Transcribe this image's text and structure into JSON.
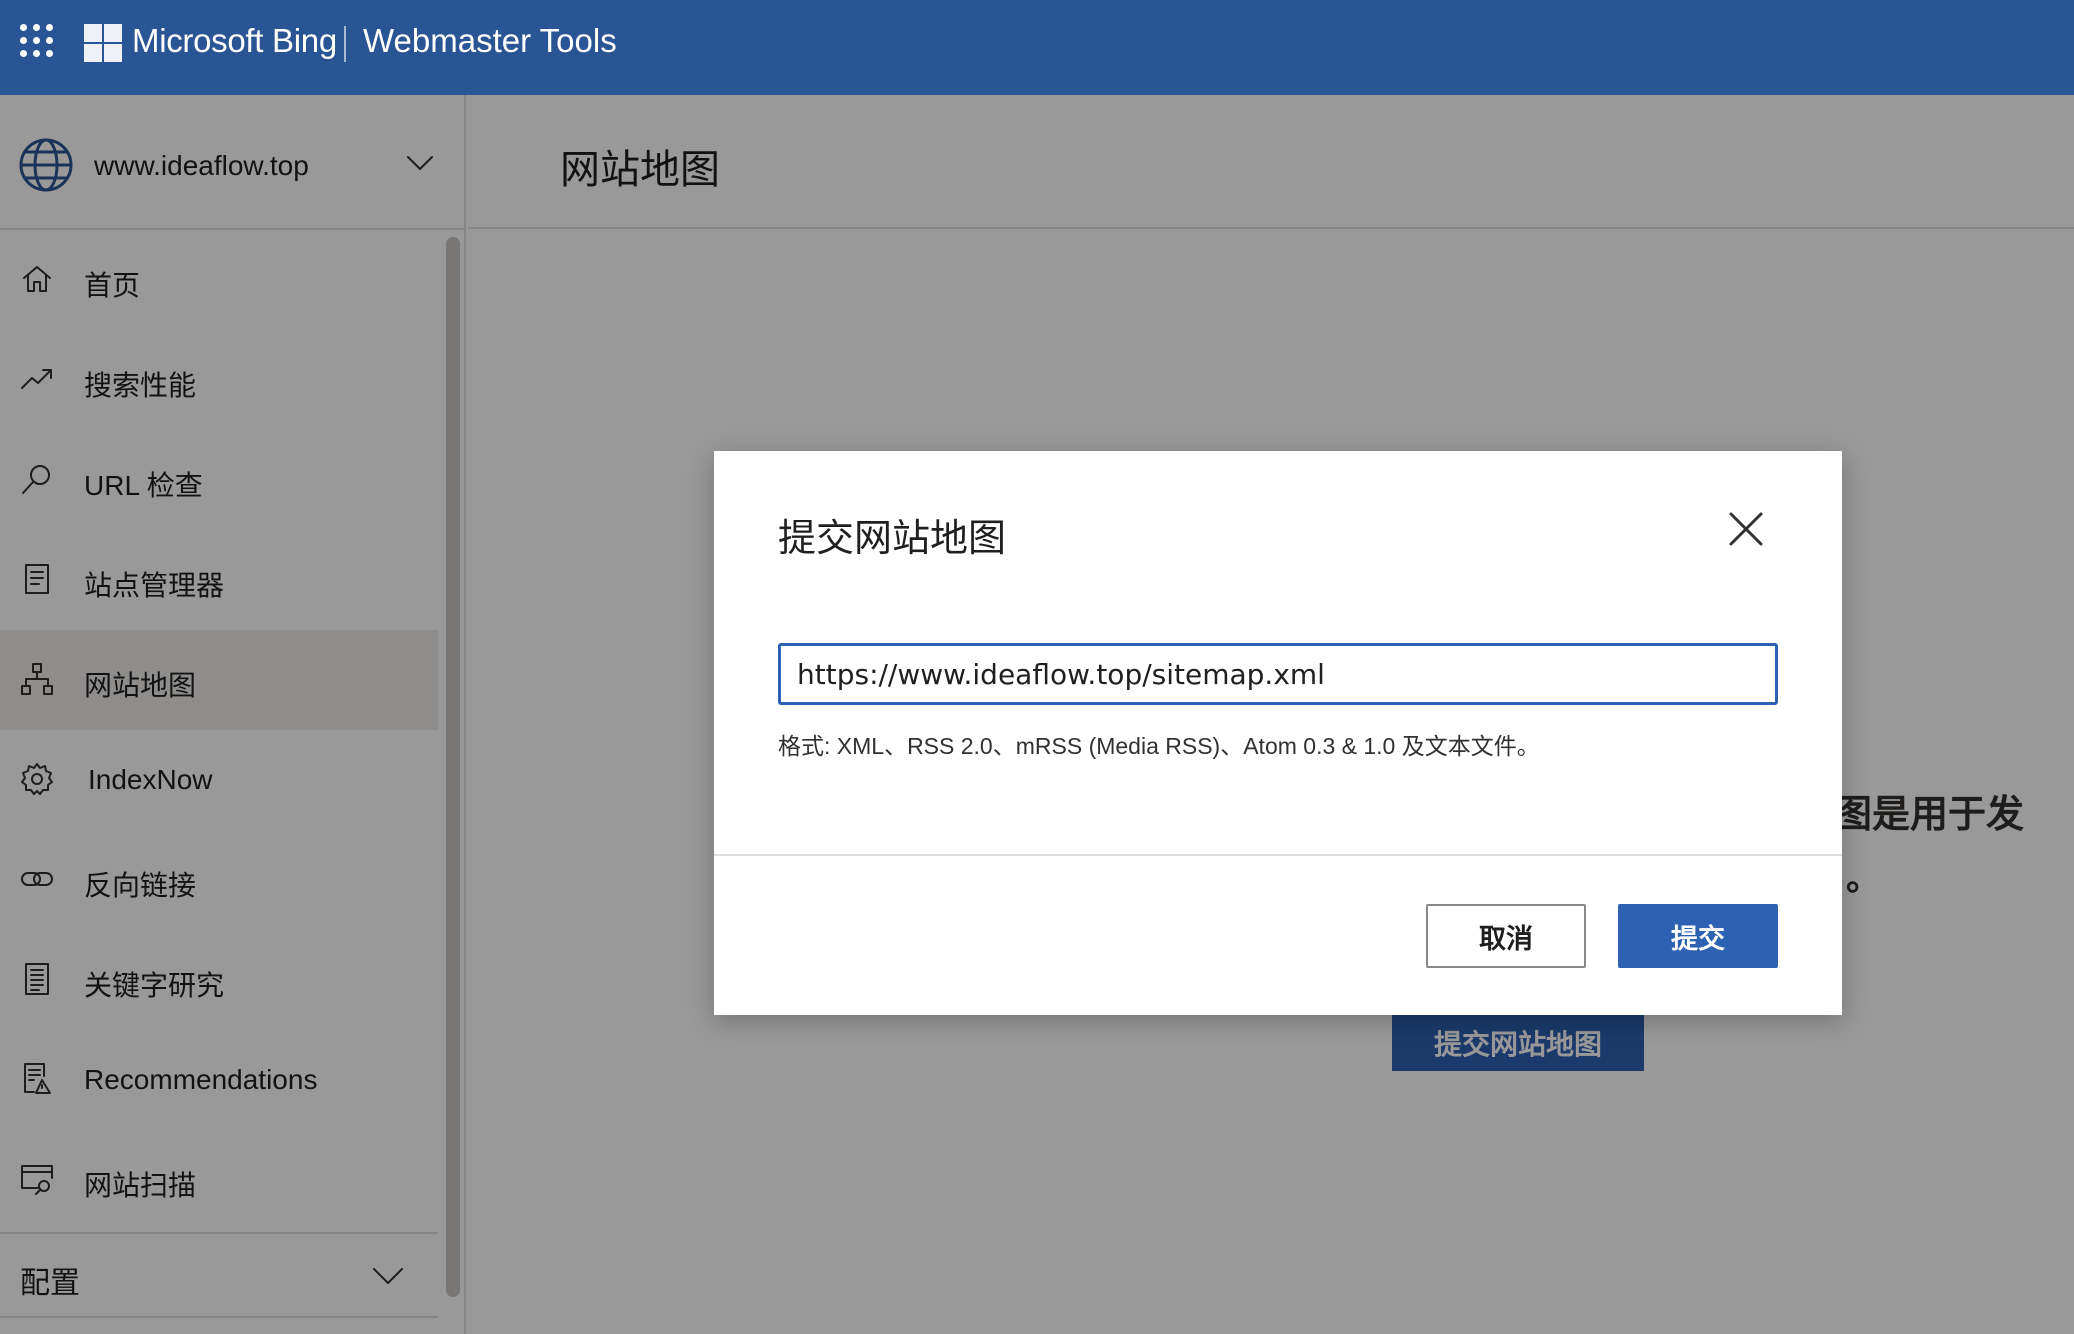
{
  "topbar": {
    "brand": "Microsoft Bing",
    "product": "Webmaster Tools"
  },
  "site": {
    "name": "www.ideaflow.top"
  },
  "sidebar": {
    "items": [
      {
        "label": "首页",
        "icon": "home-icon"
      },
      {
        "label": "搜索性能",
        "icon": "trending-icon"
      },
      {
        "label": "URL 检查",
        "icon": "search-icon"
      },
      {
        "label": "站点管理器",
        "icon": "document-list-icon"
      },
      {
        "label": "网站地图",
        "icon": "sitemap-icon",
        "active": true
      },
      {
        "label": "IndexNow",
        "icon": "gear-icon"
      },
      {
        "label": "反向链接",
        "icon": "link-icon"
      },
      {
        "label": "关键字研究",
        "icon": "document-icon"
      },
      {
        "label": "Recommendations",
        "icon": "recommendations-icon"
      },
      {
        "label": "网站扫描",
        "icon": "browser-scan-icon"
      }
    ],
    "config_label": "配置"
  },
  "main": {
    "page_title": "网站地图",
    "background_text_1": "图是用于发",
    "background_text_2": "。",
    "background_button": "提交网站地图"
  },
  "dialog": {
    "title": "提交网站地图",
    "url_value": "https://www.ideaflow.top/sitemap.xml",
    "format_hint": "格式: XML、RSS 2.0、mRSS (Media RSS)、Atom 0.3 & 1.0 及文本文件。",
    "cancel_label": "取消",
    "submit_label": "提交"
  },
  "colors": {
    "topbar": "#2a5595",
    "accent": "#2d62b3",
    "overlay": "rgba(0,0,0,0.4)"
  }
}
